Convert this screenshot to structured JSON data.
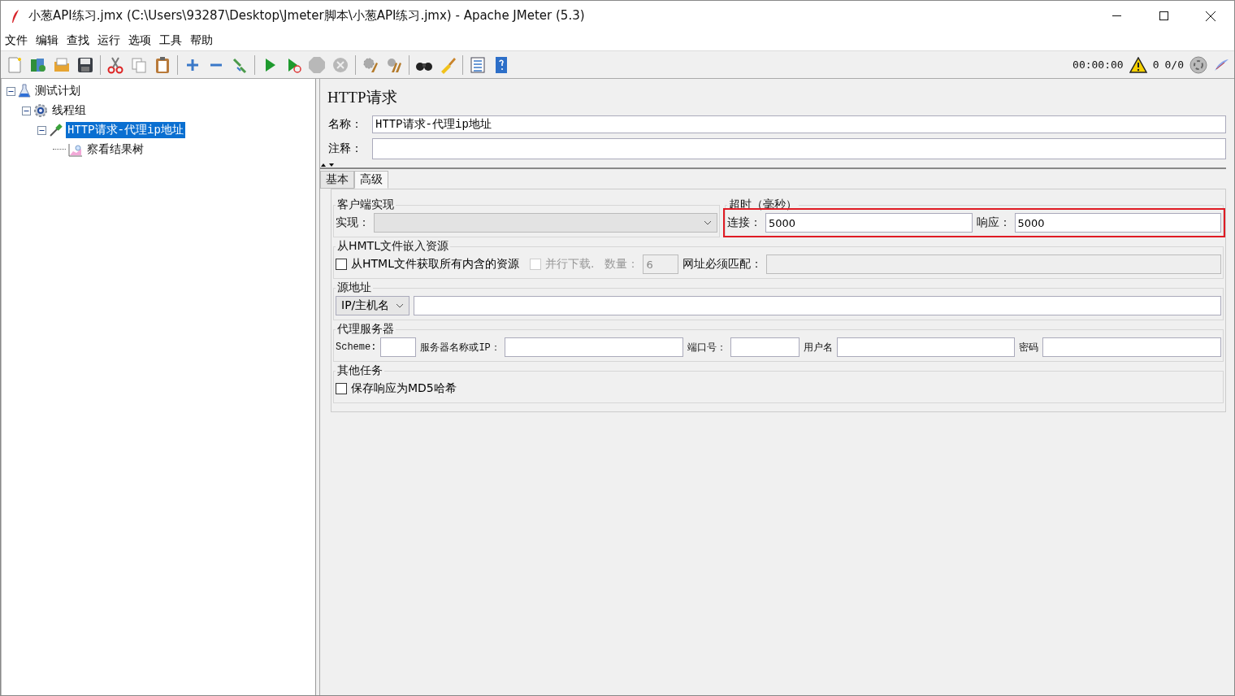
{
  "window": {
    "title": "小葱API练习.jmx (C:\\Users\\93287\\Desktop\\Jmeter脚本\\小葱API练习.jmx) - Apache JMeter (5.3)"
  },
  "menu": [
    "文件",
    "编辑",
    "查找",
    "运行",
    "选项",
    "工具",
    "帮助"
  ],
  "status": {
    "timer": "00:00:00",
    "warnings": "0",
    "threads": "0/0"
  },
  "tree": [
    {
      "label": "测试计划",
      "kind": "plan",
      "selected": false,
      "expanded": true,
      "children": [
        {
          "label": "线程组",
          "kind": "thread_group",
          "selected": false,
          "expanded": true,
          "children": [
            {
              "label": "HTTP请求-代理ip地址",
              "kind": "sampler",
              "selected": true,
              "expanded": true,
              "children": [
                {
                  "label": "察看结果树",
                  "kind": "listener",
                  "selected": false
                }
              ]
            }
          ]
        }
      ]
    }
  ],
  "panel": {
    "title": "HTTP请求",
    "name_label": "名称：",
    "name_value": "HTTP请求-代理ip地址",
    "comment_label": "注释：",
    "tabs": [
      {
        "label": "基本",
        "selected": false
      },
      {
        "label": "高级",
        "selected": true
      }
    ],
    "top_sections": [
      {
        "title": "客户端实现",
        "highlighted": false,
        "items": [
          {
            "kind": "label",
            "text": "实现："
          },
          {
            "kind": "combo",
            "value": "",
            "disabled": true
          }
        ]
      },
      {
        "title": "超时（毫秒）",
        "highlighted": true,
        "items": [
          {
            "kind": "label",
            "text": "连接："
          },
          {
            "kind": "field",
            "value": "5000",
            "disabled": false
          },
          {
            "kind": "label",
            "text": "响应："
          },
          {
            "kind": "field",
            "value": "5000",
            "disabled": false
          }
        ]
      }
    ],
    "sections": [
      {
        "title": "从HMTL文件嵌入资源",
        "highlighted": false,
        "items": [
          {
            "kind": "checkbox",
            "text": "从HTML文件获取所有内含的资源",
            "checked": false,
            "disabled": false
          },
          {
            "kind": "checkbox",
            "text": "并行下载.",
            "checked": false,
            "disabled": true
          },
          {
            "kind": "label",
            "text": "数量：",
            "disabled": true
          },
          {
            "kind": "short_field",
            "value": "6",
            "disabled": true
          },
          {
            "kind": "label",
            "text": "网址必须匹配："
          },
          {
            "kind": "field",
            "value": "",
            "disabled": true
          }
        ]
      },
      {
        "title": "源地址",
        "highlighted": false,
        "items": [
          {
            "kind": "select",
            "value": "IP/主机名",
            "disabled": false
          },
          {
            "kind": "field",
            "value": "",
            "disabled": false
          }
        ]
      },
      {
        "title": "代理服务器",
        "highlighted": false,
        "items": [
          {
            "kind": "small_label",
            "text": "Scheme:"
          },
          {
            "kind": "short_field",
            "value": "",
            "disabled": false
          },
          {
            "kind": "small_label",
            "text": "服务器名称或IP："
          },
          {
            "kind": "field",
            "value": "",
            "disabled": false
          },
          {
            "kind": "small_label",
            "text": "端口号："
          },
          {
            "kind": "mid_field",
            "value": "",
            "disabled": false
          },
          {
            "kind": "small_label",
            "text": "用户名"
          },
          {
            "kind": "field",
            "value": "",
            "disabled": false
          },
          {
            "kind": "small_label",
            "text": "密码"
          },
          {
            "kind": "field",
            "value": "",
            "disabled": false
          }
        ]
      },
      {
        "title": "其他任务",
        "highlighted": false,
        "items": [
          {
            "kind": "checkbox",
            "text": "保存响应为MD5哈希",
            "checked": false,
            "disabled": false
          }
        ]
      }
    ]
  }
}
